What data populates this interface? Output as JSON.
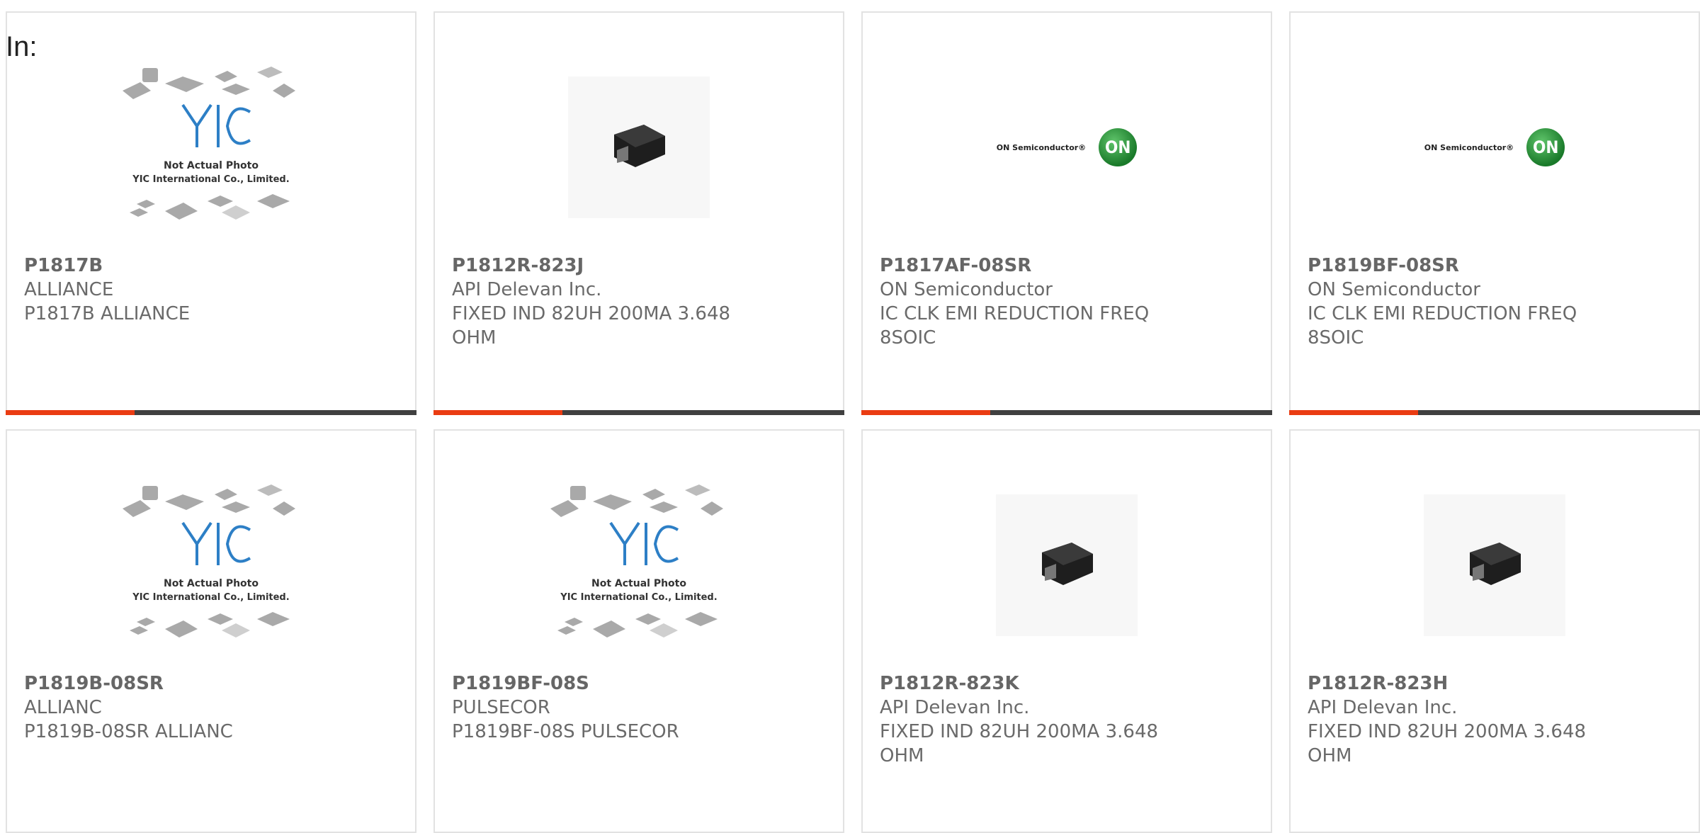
{
  "header": {
    "label": "In:"
  },
  "placeholder_caption": {
    "line1": "Not Actual Photo",
    "line2": "YIC International Co., Limited."
  },
  "onsemi_logo": {
    "wordmark": "ON Semiconductor®",
    "badge": "ON"
  },
  "accent_color": "#ea3c12",
  "products": [
    {
      "part": "P1817B",
      "mfr": "ALLIANCE",
      "desc": "P1817B ALLIANCE",
      "image": "yic-placeholder"
    },
    {
      "part": "P1812R-823J",
      "mfr": "API Delevan Inc.",
      "desc": "FIXED IND 82UH 200MA 3.648 OHM",
      "image": "inductor-photo"
    },
    {
      "part": "P1817AF-08SR",
      "mfr": "ON Semiconductor",
      "desc": "IC CLK EMI REDUCTION FREQ 8SOIC",
      "image": "onsemi-logo"
    },
    {
      "part": "P1819BF-08SR",
      "mfr": "ON Semiconductor",
      "desc": "IC CLK EMI REDUCTION FREQ 8SOIC",
      "image": "onsemi-logo"
    },
    {
      "part": "P1819B-08SR",
      "mfr": "ALLIANC",
      "desc": "P1819B-08SR ALLIANC",
      "image": "yic-placeholder"
    },
    {
      "part": "P1819BF-08S",
      "mfr": "PULSECOR",
      "desc": "P1819BF-08S PULSECOR",
      "image": "yic-placeholder"
    },
    {
      "part": "P1812R-823K",
      "mfr": "API Delevan Inc.",
      "desc": "FIXED IND 82UH 200MA 3.648 OHM",
      "image": "inductor-photo"
    },
    {
      "part": "P1812R-823H",
      "mfr": "API Delevan Inc.",
      "desc": "FIXED IND 82UH 200MA 3.648 OHM",
      "image": "inductor-photo"
    }
  ]
}
